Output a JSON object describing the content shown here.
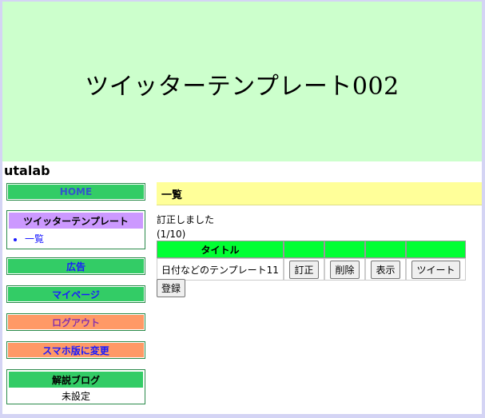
{
  "banner": {
    "title": "ツイッターテンプレート002"
  },
  "site": {
    "name": "utalab"
  },
  "sidebar": {
    "home_label": "HOME",
    "template_box": {
      "title": "ツイッターテンプレート",
      "items": [
        "一覧"
      ]
    },
    "ad_label": "広告",
    "mypage_label": "マイページ",
    "logout_label": "ログアウト",
    "mobile_label": "スマホ版に変更",
    "blog_box": {
      "title": "解説ブログ",
      "value": "未設定"
    }
  },
  "main": {
    "heading": "一覧",
    "message": "訂正しました",
    "pager": "(1/10)",
    "table": {
      "headers": [
        "タイトル",
        "",
        "",
        "",
        ""
      ],
      "rows": [
        {
          "title": "日付などのテンプレート11",
          "edit": "訂正",
          "delete": "削除",
          "view": "表示",
          "tweet": "ツイート"
        }
      ]
    },
    "register_label": "登録"
  },
  "colors": {
    "banner_bg": "#ccffcc",
    "menu_green": "#33cc66",
    "menu_orange": "#ff9966",
    "box_header": "#cc99ff",
    "heading_bg": "#ffff99",
    "table_header": "#00ff33"
  }
}
